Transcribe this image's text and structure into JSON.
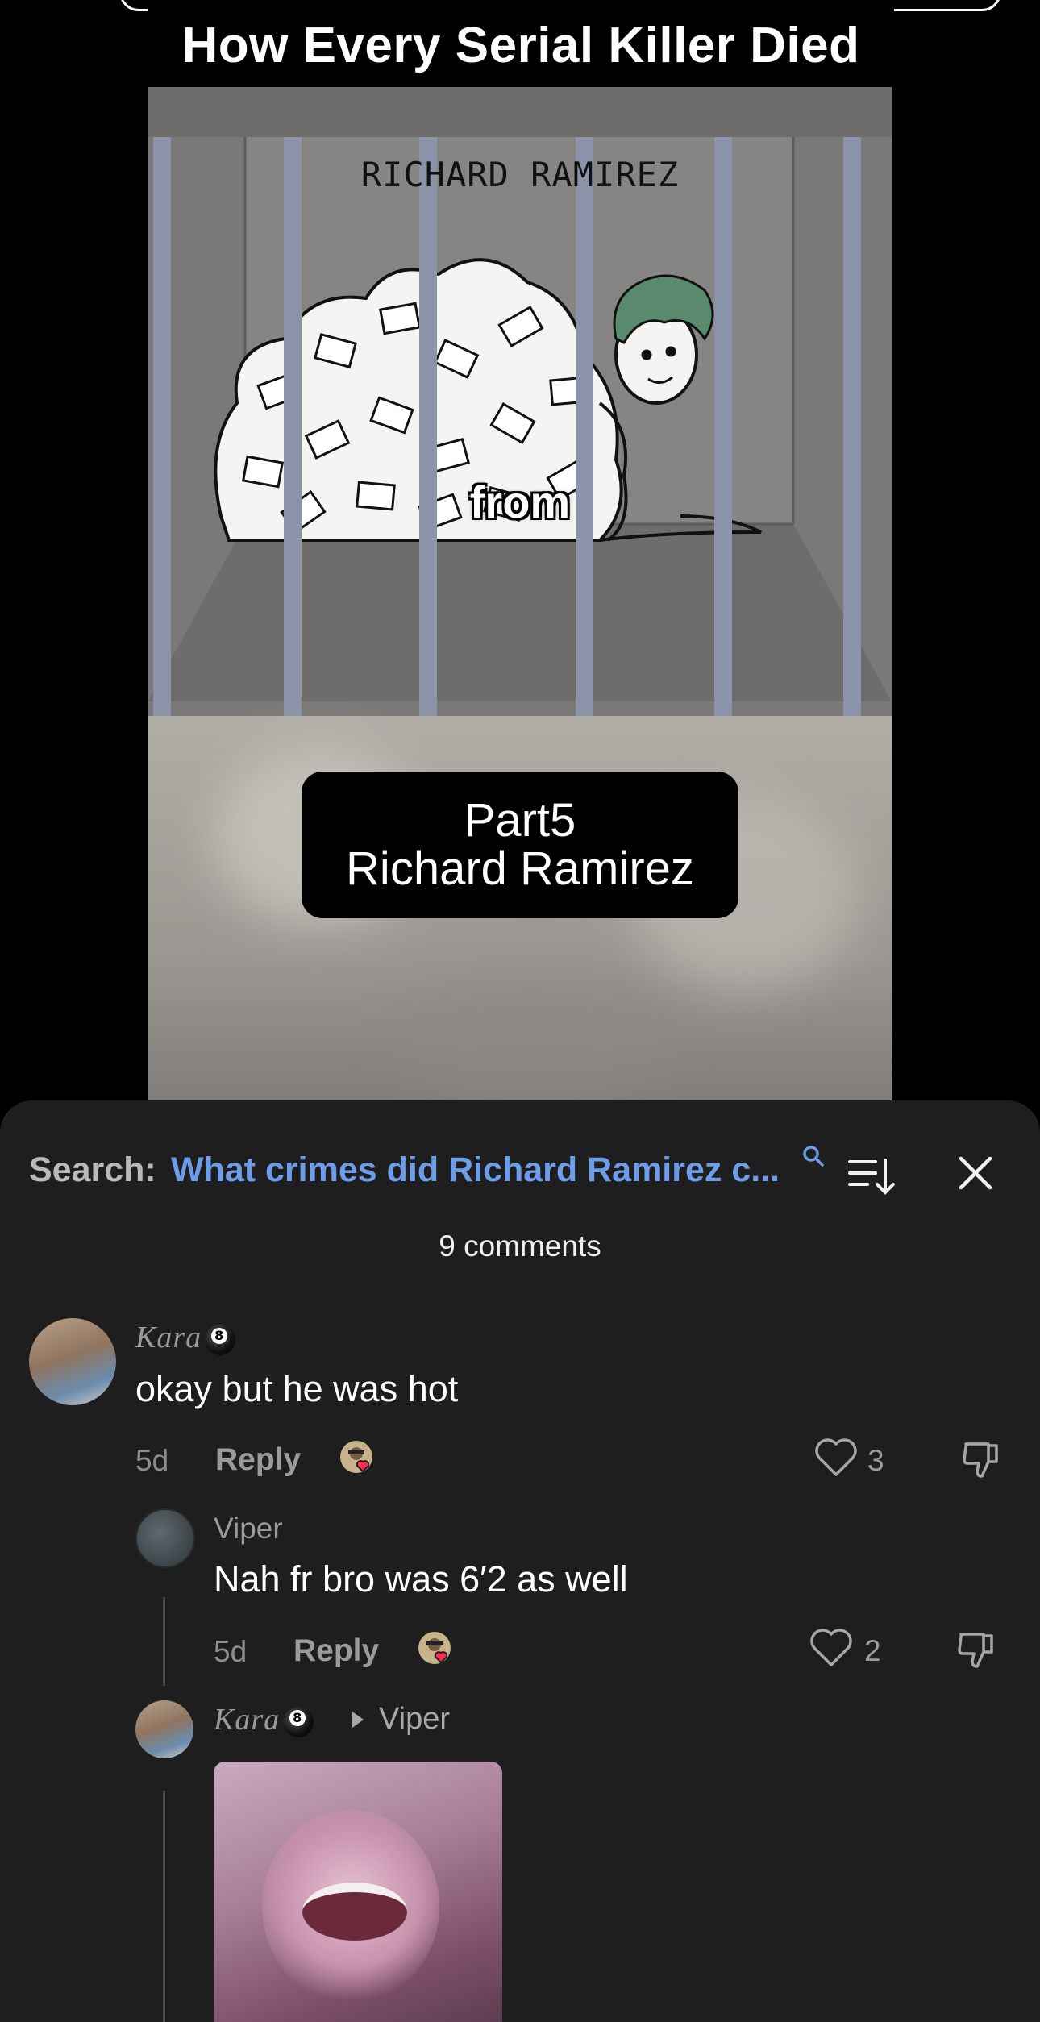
{
  "video": {
    "title": "How Every Serial Killer Died",
    "scene_label": "RICHARD RAMIREZ",
    "caption_word": "from",
    "part_line1": "Part5",
    "part_line2": "Richard Ramirez"
  },
  "comments_sheet": {
    "search_label": "Search:",
    "search_query": "What crimes did Richard Ramirez c...",
    "count_text": "9 comments",
    "comments": [
      {
        "username": "Kara",
        "badge_icon": "8-ball-icon",
        "text": "okay but he was hot",
        "time": "5d",
        "reply_label": "Reply",
        "likes": "3"
      },
      {
        "username": "Viper",
        "text": "Nah fr bro was 6′2 as well",
        "time": "5d",
        "reply_label": "Reply",
        "likes": "2"
      },
      {
        "username": "Kara",
        "badge_icon": "8-ball-icon",
        "reply_to": "Viper",
        "attachment": "gif-image"
      }
    ]
  },
  "colors": {
    "sheet_bg": "#1e1e1f",
    "search_query": "#6d9de8",
    "heart_badge": "#fe2c55"
  }
}
